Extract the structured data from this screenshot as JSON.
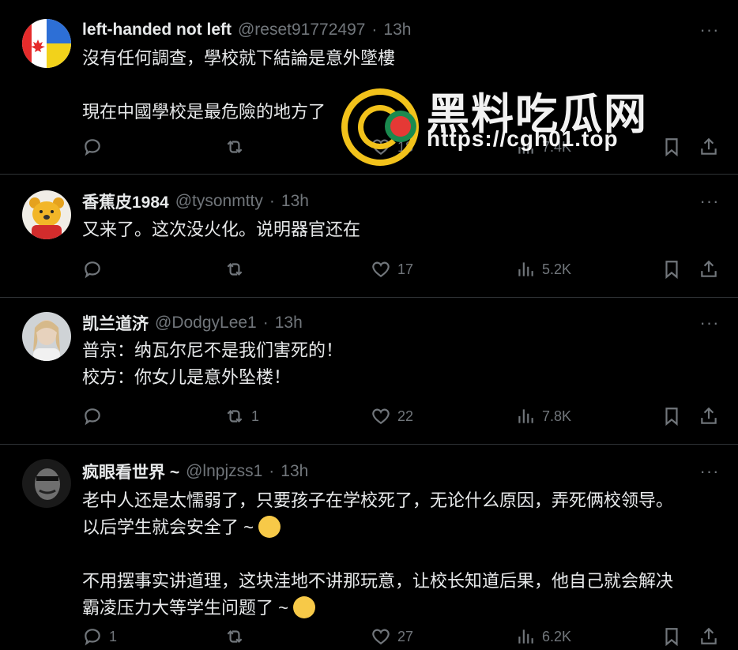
{
  "tweets": [
    {
      "name": "left-handed not left",
      "handle": "@reset91772497",
      "dot": "·",
      "time": "13h",
      "text": "沒有任何調查，學校就下結論是意外墜樓\n\n現在中國學校是最危險的地方了",
      "reply_count": "",
      "retweet_count": "",
      "like_count": "18",
      "views": "7.4K",
      "avatar_icon": "flag-avatar-icon"
    },
    {
      "name": "香蕉皮1984",
      "handle": "@tysonmtty",
      "dot": "·",
      "time": "13h",
      "text": "又来了。这次没火化。说明器官还在",
      "reply_count": "",
      "retweet_count": "",
      "like_count": "17",
      "views": "5.2K",
      "avatar_icon": "bear-avatar-icon"
    },
    {
      "name": "凯兰道济",
      "handle": "@DodgyLee1",
      "dot": "·",
      "time": "13h",
      "text": "普京：纳瓦尔尼不是我们害死的！\n校方：你女儿是意外坠楼！",
      "reply_count": "",
      "retweet_count": "1",
      "like_count": "22",
      "views": "7.8K",
      "avatar_icon": "portrait-avatar-icon"
    },
    {
      "name": "疯眼看世界 ~",
      "handle": "@lnpjzss1",
      "dot": "·",
      "time": "13h",
      "text_line1": "老中人还是太懦弱了，只要孩子在学校死了，无论什么原因，弄死俩校领导。",
      "text_line2": "以后学生就会安全了 ~",
      "text_line3": "不用摆事实讲道理，这块洼地不讲那玩意，让校长知道后果，他自己就会解决",
      "text_line4": "霸凌压力大等学生问题了 ~",
      "reply_count": "1",
      "retweet_count": "",
      "like_count": "27",
      "views": "6.2K",
      "avatar_icon": "masked-face-avatar-icon"
    }
  ],
  "watermark": {
    "title": "黑料吃瓜网",
    "url": "https://cgh01.top"
  },
  "more_glyph": "···",
  "colors": {
    "background": "#000000",
    "text": "#e7e9ea",
    "muted": "#71767b",
    "divider": "#2f3336",
    "watermark_gold": "#f2c21b"
  }
}
